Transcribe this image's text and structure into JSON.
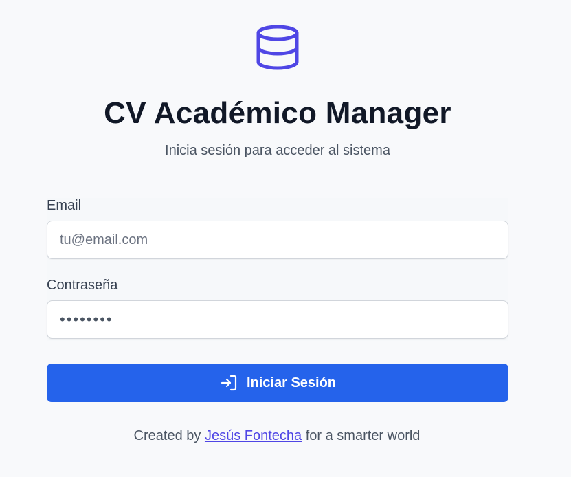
{
  "app": {
    "title": "CV Académico Manager",
    "subtitle": "Inicia sesión para acceder al sistema",
    "logo_icon": "database-icon",
    "accent_color": "#4f46e5"
  },
  "form": {
    "email_label": "Email",
    "email_placeholder": "tu@email.com",
    "email_value": "",
    "password_label": "Contraseña",
    "password_value": "abcdefgh",
    "submit_label": "Iniciar Sesión",
    "submit_icon": "login-icon",
    "submit_color": "#2563eb"
  },
  "footer": {
    "prefix": "Created by",
    "author": "Jesús Fontecha",
    "suffix": "for a smarter world"
  }
}
